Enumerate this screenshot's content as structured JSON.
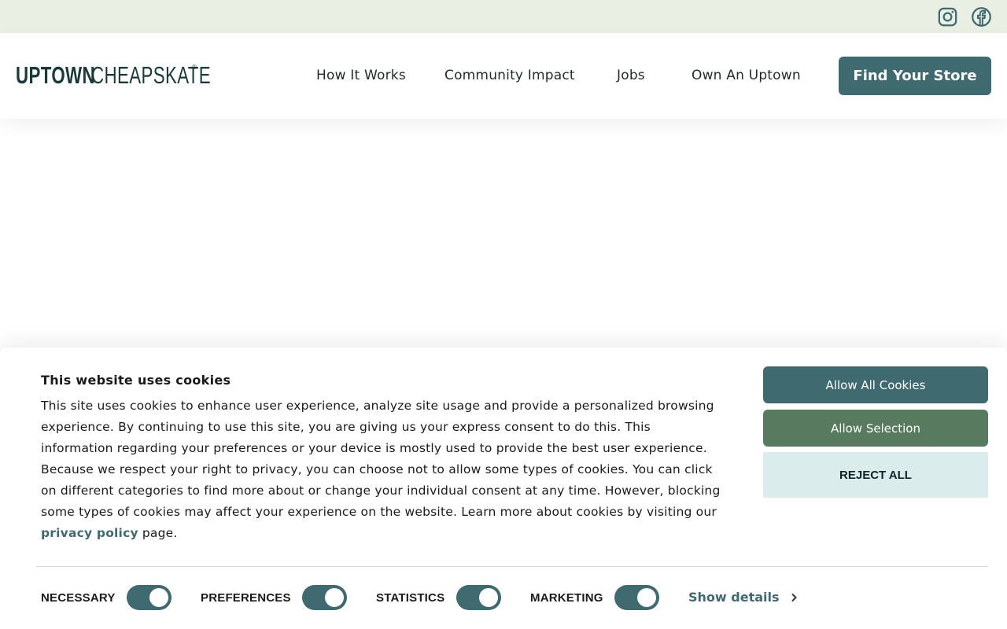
{
  "colors": {
    "brand_teal": "#3f6a70",
    "brand_green": "#587a5e",
    "topbar_bg": "#e9efe3",
    "reject_bg": "#dbecec"
  },
  "topbar": {
    "icons": [
      "instagram-icon",
      "facebook-icon"
    ]
  },
  "header": {
    "logo": {
      "bold": "UPTOWN",
      "light": "CHEAPSKATE",
      "mark": "®"
    },
    "nav": [
      {
        "label": "How It Works"
      },
      {
        "label": "Community Impact"
      },
      {
        "label": "Jobs"
      },
      {
        "label": "Own An Uptown"
      }
    ],
    "cta_label": "Find Your Store"
  },
  "cookie_banner": {
    "title": "This website uses cookies",
    "body_text": "This site uses cookies to enhance user experience, analyze site usage and provide a personalized browsing experience. By continuing to use this site, you are giving us your express consent to do this. This information regarding your preferences or your device is mostly used to provide the best user experience. Because we respect your right to privacy, you can choose not to allow some types of cookies. You can click on different categories to find more about or change your individual consent at any time. However, blocking some types of cookies may affect your experience on the website. Learn more about cookies by visiting our ",
    "link_text": "privacy policy",
    "body_suffix": " page.",
    "buttons": {
      "allow_all": "Allow All Cookies",
      "allow_selection": "Allow Selection",
      "reject_all": "REJECT ALL"
    },
    "categories": [
      {
        "label": "NECESSARY",
        "enabled": true
      },
      {
        "label": "PREFERENCES",
        "enabled": true
      },
      {
        "label": "STATISTICS",
        "enabled": true
      },
      {
        "label": "MARKETING",
        "enabled": true
      }
    ],
    "show_details": "Show details"
  }
}
